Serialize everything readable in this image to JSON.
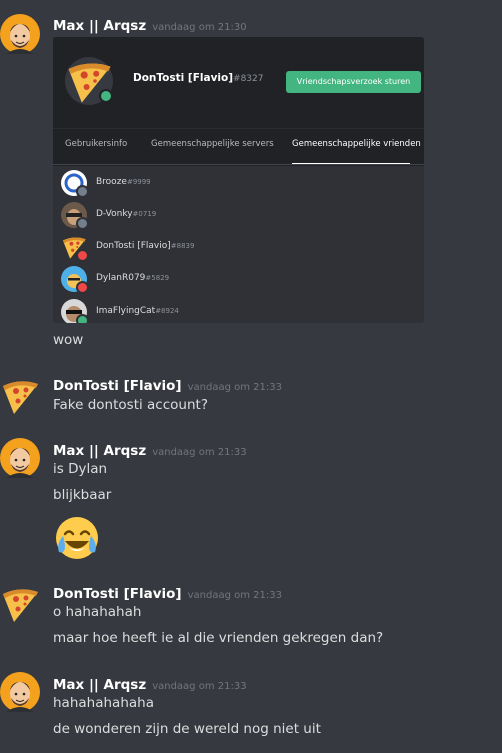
{
  "messages": [
    {
      "author": "Max || Arqsz",
      "timestamp": "vandaag om 21:30",
      "lines": [
        "wow"
      ]
    },
    {
      "author": "DonTosti [Flavio]",
      "timestamp": "vandaag om 21:33",
      "lines": [
        "Fake dontosti account?"
      ]
    },
    {
      "author": "Max || Arqsz",
      "timestamp": "vandaag om 21:33",
      "lines": [
        "is Dylan",
        "blijkbaar"
      ],
      "emoji": "joy-emoji"
    },
    {
      "author": "DonTosti [Flavio]",
      "timestamp": "vandaag om 21:33",
      "lines": [
        "o hahahahah",
        "maar hoe heeft ie al die vrienden gekregen dan?"
      ]
    },
    {
      "author": "Max || Arqsz",
      "timestamp": "vandaag om 21:33",
      "lines": [
        "hahahahahaha",
        "de wonderen zijn de wereld nog niet uit"
      ]
    }
  ],
  "embed": {
    "profile_name": "DonTosti [Flavio]",
    "profile_disc": "#8327",
    "add_friend_label": "Vriendschapsverzoek sturen",
    "tabs": [
      "Gebruikersinfo",
      "Gemeenschappelijke servers",
      "Gemeenschappelijke vrienden"
    ],
    "active_tab": "Gemeenschappelijke vrienden",
    "friends": [
      {
        "name": "Brooze",
        "disc": "#9999",
        "status": "offline"
      },
      {
        "name": "D-Vonky",
        "disc": "#0719",
        "status": "offline"
      },
      {
        "name": "DonTosti [Flavio]",
        "disc": "#8839",
        "status": "dnd"
      },
      {
        "name": "DylanR079",
        "disc": "#5829",
        "status": "dnd"
      },
      {
        "name": "ImaFlyingCat",
        "disc": "#8924",
        "status": "online"
      }
    ]
  },
  "colors": {
    "background": "#36393f",
    "online": "#43b581",
    "dnd": "#f04747",
    "offline": "#747f8d",
    "button": "#43b581"
  }
}
